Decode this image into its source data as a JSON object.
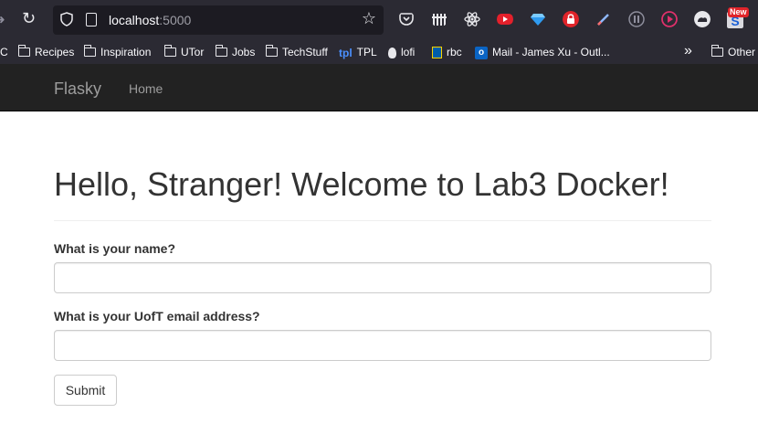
{
  "browser": {
    "url_host": "localhost",
    "url_port": ":5000",
    "new_badge": "New"
  },
  "bookmarks": [
    {
      "label": "C",
      "icon": "truncated-bookmark"
    },
    {
      "label": "Recipes",
      "icon": "folder-icon"
    },
    {
      "label": "Inspiration",
      "icon": "folder-icon"
    },
    {
      "label": "UTor",
      "icon": "folder-icon"
    },
    {
      "label": "Jobs",
      "icon": "folder-icon"
    },
    {
      "label": "TechStuff",
      "icon": "folder-icon"
    },
    {
      "label": "TPL",
      "icon": "tpl-icon"
    },
    {
      "label": "lofi",
      "icon": "lofi-icon"
    },
    {
      "label": "rbc",
      "icon": "rbc-icon"
    },
    {
      "label": "Mail - James Xu - Outl...",
      "icon": "outlook-icon"
    },
    {
      "label": "Other",
      "icon": "folder-icon"
    }
  ],
  "navbar": {
    "brand": "Flasky",
    "home": "Home"
  },
  "page": {
    "heading": "Hello, Stranger! Welcome to Lab3 Docker!",
    "name_label": "What is your name?",
    "name_value": "",
    "email_label": "What is your UofT email address?",
    "email_value": "",
    "submit_label": "Submit"
  },
  "colors": {
    "toolbar_bg": "#2b2a33",
    "navbar_bg": "#222222",
    "navbar_text": "#9d9d9d",
    "heading_text": "#333333"
  }
}
